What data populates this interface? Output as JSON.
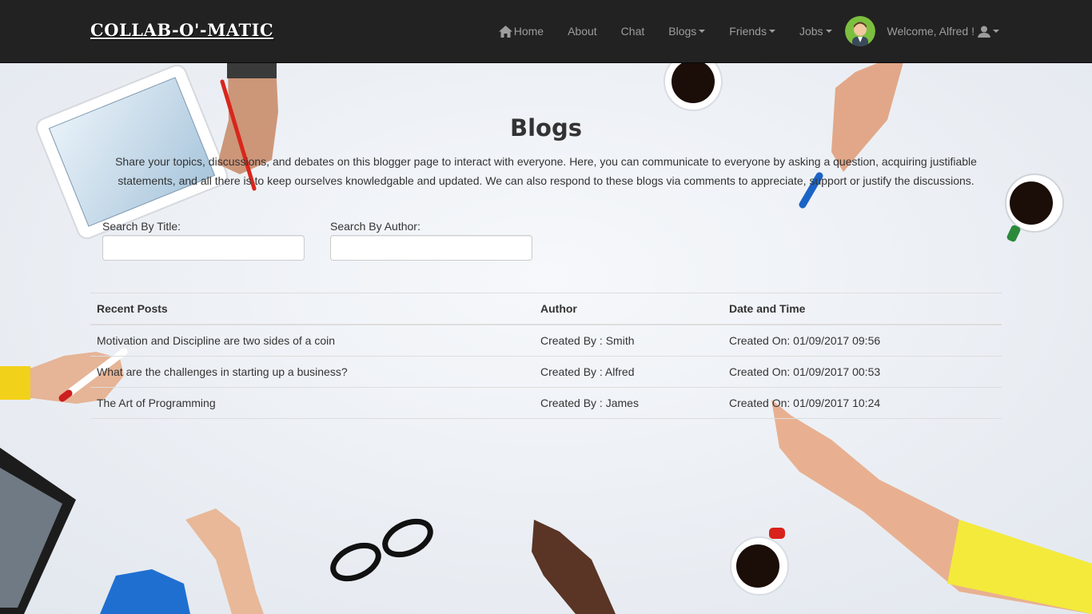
{
  "brand": "COLLAB-O'-MATIC",
  "nav": {
    "home": "Home",
    "about": "About",
    "chat": "Chat",
    "blogs": "Blogs",
    "friends": "Friends",
    "jobs": "Jobs",
    "welcome": "Welcome, Alfred !"
  },
  "page": {
    "title": "Blogs",
    "intro": "Share your topics, discussions, and debates on this blogger page to interact with everyone. Here, you can communicate to everyone by asking a question, acquiring justifiable statements, and all there is to keep ourselves knowledgable and updated. We can also respond to these blogs via comments to appreciate, support or justify the discussions."
  },
  "search": {
    "title_label": "Search By Title:",
    "title_value": "",
    "author_label": "Search By Author:",
    "author_value": ""
  },
  "table": {
    "headers": [
      "Recent Posts",
      "Author",
      "Date and Time"
    ],
    "rows": [
      [
        "Motivation and Discipline are two sides of a coin",
        "Created By : Smith",
        "Created On: 01/09/2017 09:56"
      ],
      [
        "What are the challenges in starting up a business?",
        "Created By : Alfred",
        "Created On: 01/09/2017 00:53"
      ],
      [
        "The Art of Programming",
        "Created By : James",
        "Created On: 01/09/2017 10:24"
      ]
    ]
  },
  "icons": {
    "home": "home-icon",
    "user": "user-icon",
    "avatar": "avatar"
  }
}
